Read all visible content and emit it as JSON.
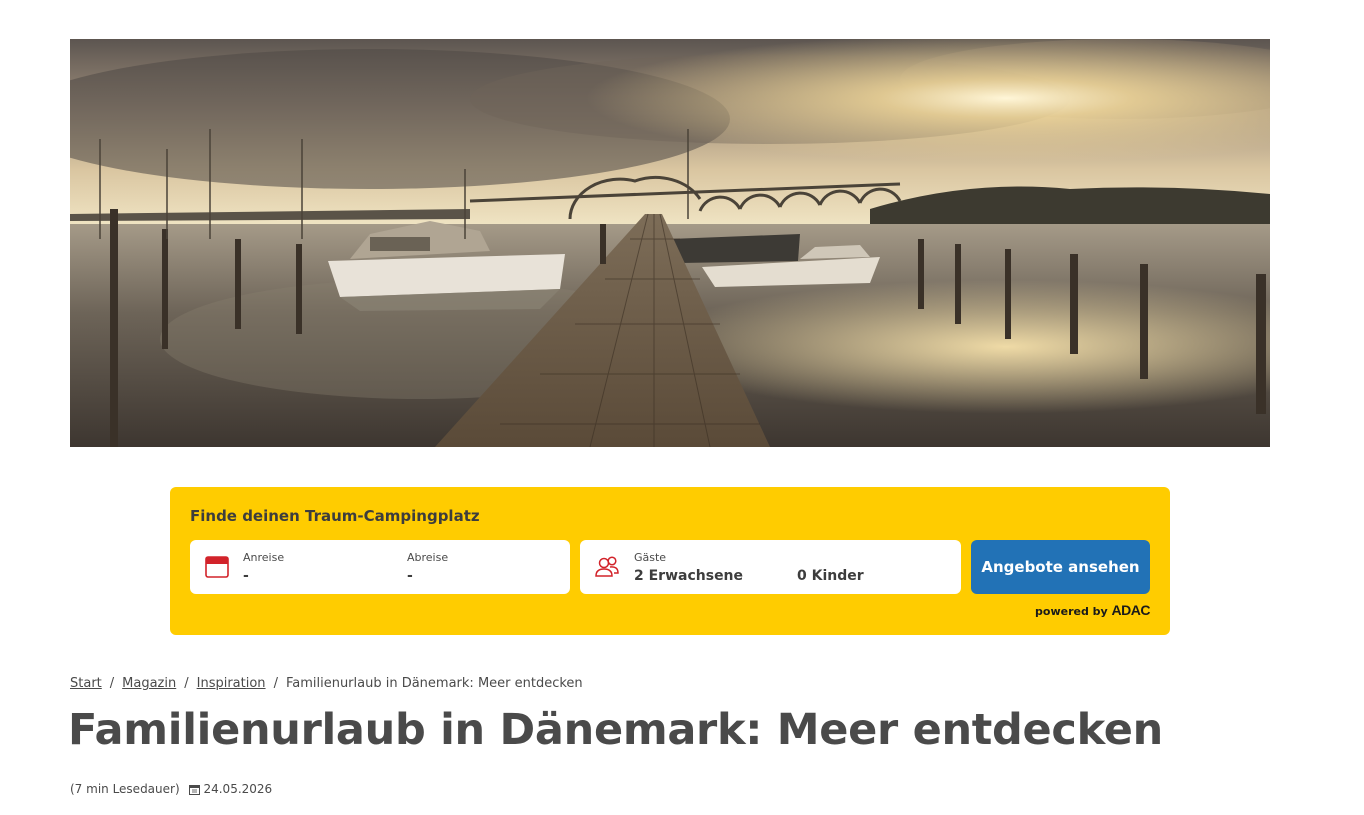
{
  "search": {
    "title": "Finde deinen Traum-Campingplatz",
    "arrival_label": "Anreise",
    "arrival_value": "-",
    "departure_label": "Abreise",
    "departure_value": "-",
    "guests_label": "Gäste",
    "adults_value": "2 Erwachsene",
    "children_value": "0 Kinder",
    "submit_label": "Angebote ansehen",
    "powered_by_label": "powered by",
    "powered_by_brand": "ADAC"
  },
  "breadcrumb": {
    "items": [
      "Start",
      "Magazin",
      "Inspiration"
    ],
    "current": "Familienurlaub in Dänemark: Meer entdecken",
    "separator": "/"
  },
  "article": {
    "title": "Familienurlaub in Dänemark: Meer entdecken",
    "reading_time": "(7 min Lesedauer)",
    "date": "24.05.2026"
  },
  "colors": {
    "accent_yellow": "#ffcc00",
    "button_blue": "#2272b6",
    "icon_red": "#d2232a"
  },
  "icons": {
    "dates": "calendar-icon",
    "guests": "users-icon",
    "meta_date": "calendar-icon"
  }
}
